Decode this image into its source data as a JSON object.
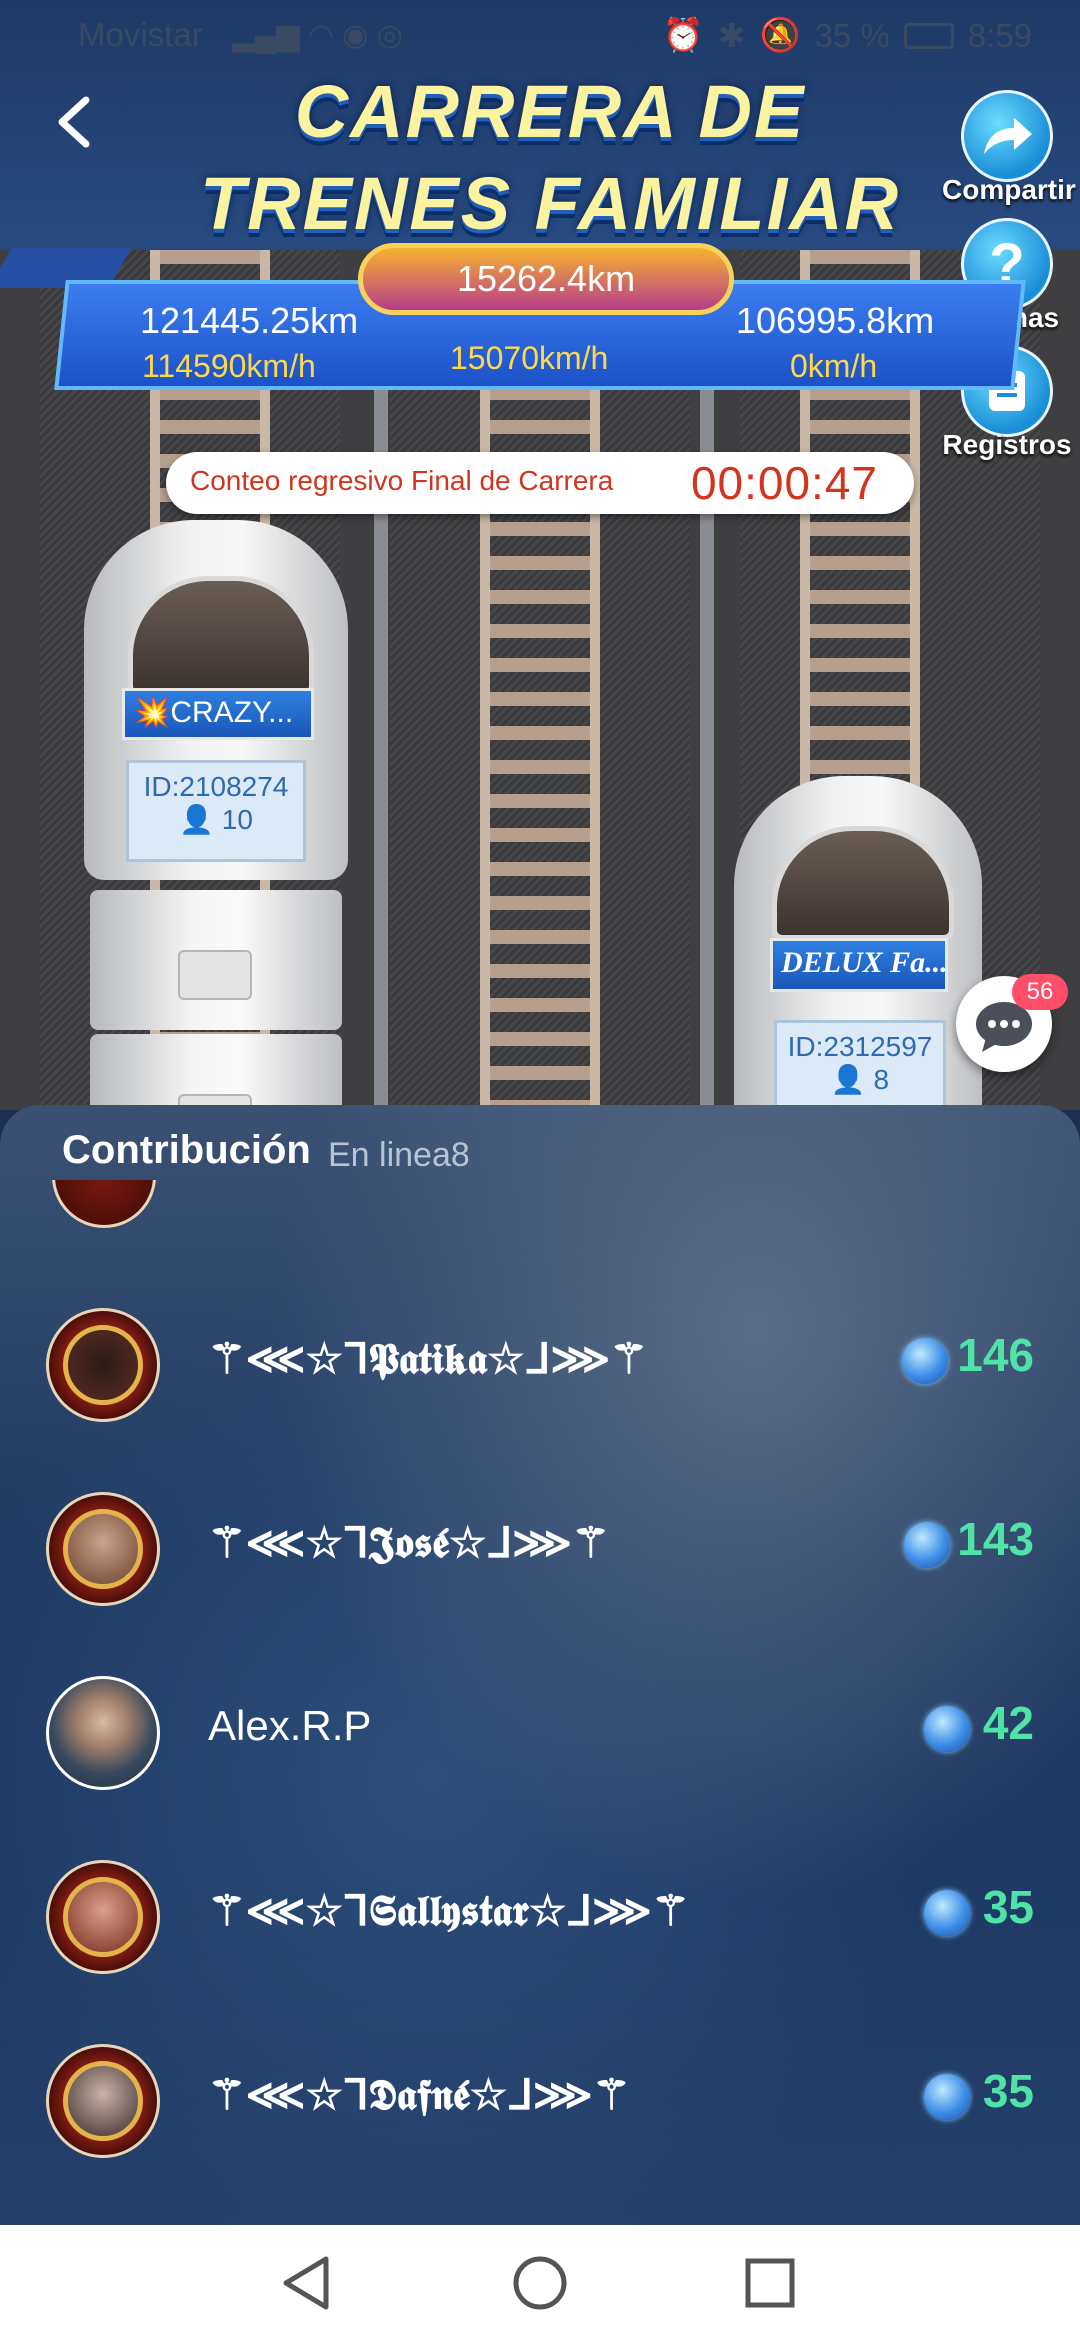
{
  "status_bar": {
    "carrier": "Movistar",
    "battery": "35 %",
    "time": "8:59"
  },
  "header": {
    "title_line1": "CARRERA DE",
    "title_line2": "TRENES FAMILIAR"
  },
  "side_buttons": {
    "share": "Compartir",
    "rules": "Normas",
    "records": "Registros"
  },
  "scoreboard": {
    "center_distance": "15262.4km",
    "center_speed": "15070km/h",
    "left_distance": "121445.25km",
    "left_speed": "114590km/h",
    "right_distance": "106995.8km",
    "right_speed": "0km/h"
  },
  "countdown": {
    "label": "Conteo regresivo Final de Carrera",
    "time": "00:00:47"
  },
  "trains": [
    {
      "name": "💥CRAZY...",
      "id": "ID:2108274",
      "members": "10"
    },
    {
      "name": "DELUX Fa...",
      "id": "ID:2312597",
      "members": "8"
    }
  ],
  "chat": {
    "badge": "56"
  },
  "panel": {
    "title": "Contribución",
    "subtitle": "En linea8"
  },
  "contributors": [
    {
      "name": "⚚⋘☆ᒣ𝕻𝖆𝖙𝖎𝖐𝖆☆ᒧ⋙⚚",
      "score": "146"
    },
    {
      "name": "⚚⋘☆ᒣ𝕵𝖔𝖘𝖊́☆ᒧ⋙⚚",
      "score": "143"
    },
    {
      "name": "Alex.R.P",
      "score": "42"
    },
    {
      "name": "⚚⋘☆ᒣ𝕾𝖆𝖑𝖑𝖞𝖘𝖙𝖆𝖗☆ᒧ⋙⚚",
      "score": "35"
    },
    {
      "name": "⚚⋘☆ᒣ𝕯𝖆𝖋𝖓𝖊́☆ᒧ⋙⚚",
      "score": "35"
    }
  ],
  "colors": {
    "score_green": "#4fe3a8",
    "countdown_red": "#d1351d",
    "speed_yellow": "#ffd84a"
  }
}
